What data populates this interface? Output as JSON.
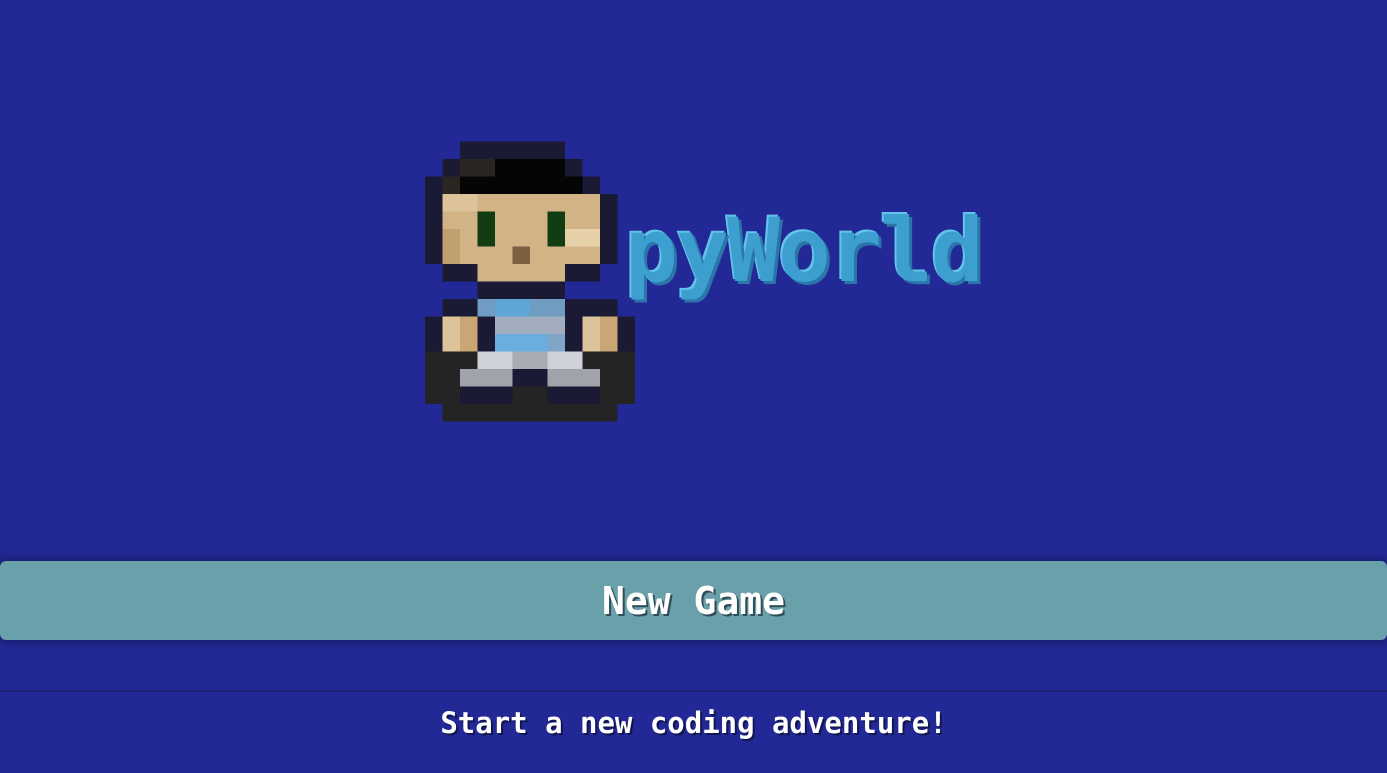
{
  "game": {
    "title": "pyWorld"
  },
  "menu": {
    "new_game_label": "New Game",
    "new_game_description": "Start a new coding adventure!"
  },
  "colors": {
    "background": "#222895",
    "button": "#6aa0aa",
    "title": "#3d9fd0",
    "text": "#ffffff"
  },
  "icons": {
    "character": "pixel-art-character-icon"
  }
}
